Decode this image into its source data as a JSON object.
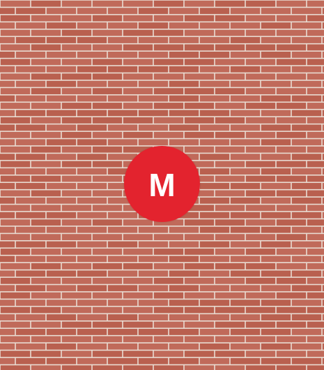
{
  "background": {
    "name": "brick-wall-texture",
    "brick_color": "#c06a5a",
    "brick_color_alt": "#b9604f",
    "mortar_color": "#e9dcd2"
  },
  "logo": {
    "letter": "M",
    "background_color": "#e3232e",
    "text_color": "#ffffff"
  }
}
